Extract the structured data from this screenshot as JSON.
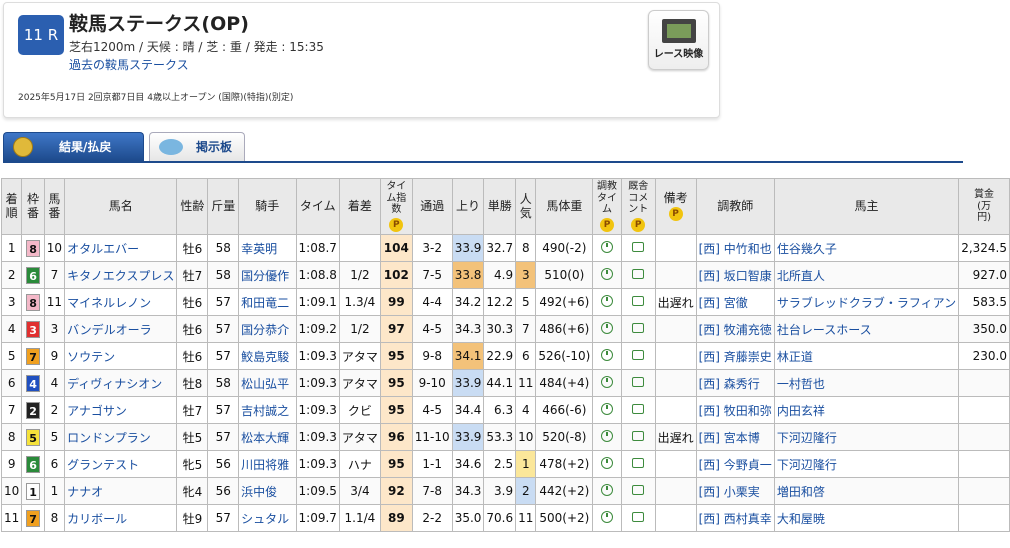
{
  "race": {
    "round": "11 R",
    "name": "鞍馬ステークス(OP)",
    "cond": "芝右1200m / 天候 : 晴 / 芝 : 重 / 発走 : 15:35",
    "past_link": "過去の鞍馬ステークス",
    "info": "2025年5月17日 2回京都7日目 4歳以上オープン (国際)(特指)(別定)",
    "video_label": "レース映像"
  },
  "tabs": {
    "results": "結果/払戻",
    "board": "掲示板"
  },
  "headers": [
    "着順",
    "枠番",
    "馬番",
    "馬名",
    "性齢",
    "斤量",
    "騎手",
    "タイム",
    "着差",
    "タイム指数",
    "通過",
    "上り",
    "単勝",
    "人気",
    "馬体重",
    "調教タイム",
    "厩舎コメント",
    "備考",
    "調教師",
    "馬主",
    "賞金(万円)"
  ],
  "rows": [
    {
      "rank": "1",
      "waku": "8",
      "num": "10",
      "horse": "オタルエバー",
      "sexage": "牡6",
      "weight": "58",
      "jockey": "幸英明",
      "time": "1:08.7",
      "margin": "",
      "idx": "104",
      "pass": "3-2",
      "last": "33.9",
      "odds": "32.7",
      "pop": "8",
      "body": "490(-2)",
      "note": "",
      "trainer": "[西] 中竹和也",
      "owner": "住谷幾久子",
      "prize": "2,324.5"
    },
    {
      "rank": "2",
      "waku": "6",
      "num": "7",
      "horse": "キタノエクスプレス",
      "sexage": "牡7",
      "weight": "58",
      "jockey": "国分優作",
      "time": "1:08.8",
      "margin": "1/2",
      "idx": "102",
      "pass": "7-5",
      "last": "33.8",
      "odds": "4.9",
      "pop": "3",
      "body": "510(0)",
      "note": "",
      "trainer": "[西] 坂口智康",
      "owner": "北所直人",
      "prize": "927.0"
    },
    {
      "rank": "3",
      "waku": "8",
      "num": "11",
      "horse": "マイネルレノン",
      "sexage": "牡6",
      "weight": "57",
      "jockey": "和田竜二",
      "time": "1:09.1",
      "margin": "1.3/4",
      "idx": "99",
      "pass": "4-4",
      "last": "34.2",
      "odds": "12.2",
      "pop": "5",
      "body": "492(+6)",
      "note": "出遅れ",
      "trainer": "[西] 宮徹",
      "owner": "サラブレッドクラブ・ラフィアン",
      "prize": "583.5"
    },
    {
      "rank": "4",
      "waku": "3",
      "num": "3",
      "horse": "バンデルオーラ",
      "sexage": "牡6",
      "weight": "57",
      "jockey": "国分恭介",
      "time": "1:09.2",
      "margin": "1/2",
      "idx": "97",
      "pass": "4-5",
      "last": "34.3",
      "odds": "30.3",
      "pop": "7",
      "body": "486(+6)",
      "note": "",
      "trainer": "[西] 牧浦充徳",
      "owner": "社台レースホース",
      "prize": "350.0"
    },
    {
      "rank": "5",
      "waku": "7",
      "num": "9",
      "horse": "ソウテン",
      "sexage": "牡6",
      "weight": "57",
      "jockey": "鮫島克駿",
      "time": "1:09.3",
      "margin": "アタマ",
      "idx": "95",
      "pass": "9-8",
      "last": "34.1",
      "odds": "22.9",
      "pop": "6",
      "body": "526(-10)",
      "note": "",
      "trainer": "[西] 斉藤崇史",
      "owner": "林正道",
      "prize": "230.0"
    },
    {
      "rank": "6",
      "waku": "4",
      "num": "4",
      "horse": "ディヴィナシオン",
      "sexage": "牡8",
      "weight": "58",
      "jockey": "松山弘平",
      "time": "1:09.3",
      "margin": "アタマ",
      "idx": "95",
      "pass": "9-10",
      "last": "33.9",
      "odds": "44.1",
      "pop": "11",
      "body": "484(+4)",
      "note": "",
      "trainer": "[西] 森秀行",
      "owner": "一村哲也",
      "prize": ""
    },
    {
      "rank": "7",
      "waku": "2",
      "num": "2",
      "horse": "アナゴサン",
      "sexage": "牡7",
      "weight": "57",
      "jockey": "吉村誠之",
      "time": "1:09.3",
      "margin": "クビ",
      "idx": "95",
      "pass": "4-5",
      "last": "34.4",
      "odds": "6.3",
      "pop": "4",
      "body": "466(-6)",
      "note": "",
      "trainer": "[西] 牧田和弥",
      "owner": "内田玄祥",
      "prize": ""
    },
    {
      "rank": "8",
      "waku": "5",
      "num": "5",
      "horse": "ロンドンプラン",
      "sexage": "牡5",
      "weight": "57",
      "jockey": "松本大輝",
      "time": "1:09.3",
      "margin": "アタマ",
      "idx": "96",
      "pass": "11-10",
      "last": "33.9",
      "odds": "53.3",
      "pop": "10",
      "body": "520(-8)",
      "note": "出遅れ",
      "trainer": "[西] 宮本博",
      "owner": "下河辺隆行",
      "prize": ""
    },
    {
      "rank": "9",
      "waku": "6",
      "num": "6",
      "horse": "グランテスト",
      "sexage": "牝5",
      "weight": "56",
      "jockey": "川田将雅",
      "time": "1:09.3",
      "margin": "ハナ",
      "idx": "95",
      "pass": "1-1",
      "last": "34.6",
      "odds": "2.5",
      "pop": "1",
      "body": "478(+2)",
      "note": "",
      "trainer": "[西] 今野貞一",
      "owner": "下河辺隆行",
      "prize": ""
    },
    {
      "rank": "10",
      "waku": "1",
      "num": "1",
      "horse": "ナナオ",
      "sexage": "牝4",
      "weight": "56",
      "jockey": "浜中俊",
      "time": "1:09.5",
      "margin": "3/4",
      "idx": "92",
      "pass": "7-8",
      "last": "34.3",
      "odds": "3.9",
      "pop": "2",
      "body": "442(+2)",
      "note": "",
      "trainer": "[西] 小栗実",
      "owner": "増田和啓",
      "prize": ""
    },
    {
      "rank": "11",
      "waku": "7",
      "num": "8",
      "horse": "カリボール",
      "sexage": "牡9",
      "weight": "57",
      "jockey": "シュタル",
      "time": "1:09.7",
      "margin": "1.1/4",
      "idx": "89",
      "pass": "2-2",
      "last": "35.0",
      "odds": "70.6",
      "pop": "11",
      "body": "500(+2)",
      "note": "",
      "trainer": "[西] 西村真幸",
      "owner": "大和屋暁",
      "prize": ""
    }
  ],
  "colors": {
    "waku": {
      "1": "#ffffff",
      "2": "#222222",
      "3": "#e03030",
      "4": "#2050c0",
      "5": "#f5e23a",
      "6": "#2a8a3a",
      "7": "#f0a020",
      "8": "#f4b8c8"
    },
    "last_fast": "#c9dcf3",
    "last_top": "#f3c27a",
    "pop1": "#fbe79a",
    "pop2": "#c9dcf3",
    "pop3": "#f3c27a"
  }
}
